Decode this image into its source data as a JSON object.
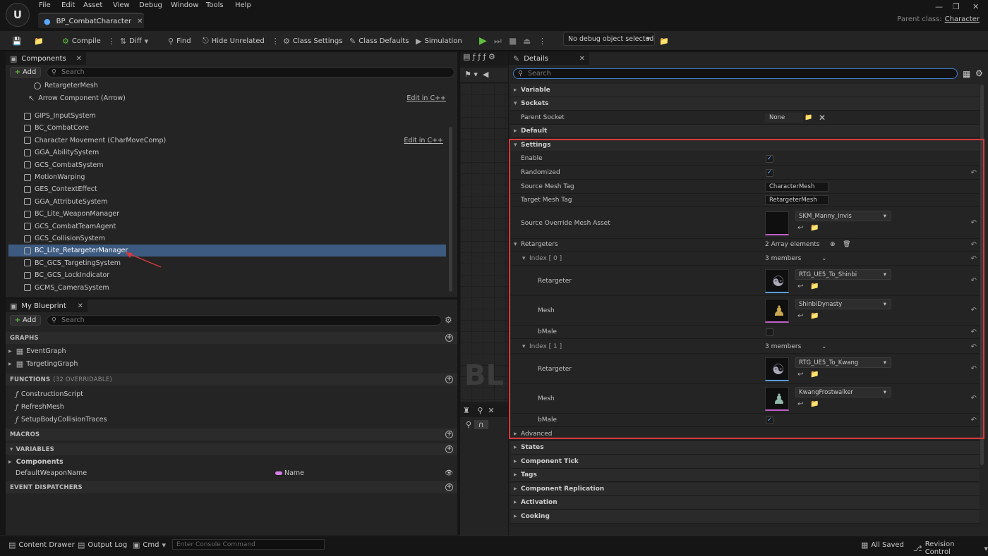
{
  "menu": [
    "File",
    "Edit",
    "Asset",
    "View",
    "Debug",
    "Window",
    "Tools",
    "Help"
  ],
  "tab": {
    "title": "BP_CombatCharacter"
  },
  "parent_class": {
    "label": "Parent class:",
    "value": "Character"
  },
  "toolbar": {
    "compile": "Compile",
    "diff": "Diff",
    "find": "Find",
    "hide_unrelated": "Hide Unrelated",
    "class_settings": "Class Settings",
    "class_defaults": "Class Defaults",
    "simulation": "Simulation",
    "debug_object": "No debug object selected"
  },
  "components": {
    "title": "Components",
    "add": "Add",
    "search_placeholder": "Search",
    "edit_cpp": "Edit in C++",
    "top_items": [
      "RetargeterMesh",
      "Arrow Component (Arrow)"
    ],
    "items": [
      "GIPS_InputSystem",
      "BC_CombatCore",
      "Character Movement (CharMoveComp)",
      "GGA_AbilitySystem",
      "GCS_CombatSystem",
      "MotionWarping",
      "GES_ContextEffect",
      "GGA_AttributeSystem",
      "BC_Lite_WeaponManager",
      "GCS_CombatTeamAgent",
      "GCS_CollisionSystem",
      "BC_Lite_RetargeterManager",
      "BC_GCS_TargetingSystem",
      "BC_GCS_LockIndicator",
      "GCMS_CameraSystem"
    ],
    "selected": "BC_Lite_RetargeterManager"
  },
  "my_blueprint": {
    "title": "My Blueprint",
    "add": "Add",
    "search_placeholder": "Search",
    "graphs_header": "GRAPHS",
    "graphs": [
      "EventGraph",
      "TargetingGraph"
    ],
    "functions_header": "FUNCTIONS",
    "functions_note": "(32 OVERRIDABLE)",
    "functions": [
      "ConstructionScript",
      "RefreshMesh",
      "SetupBodyCollisionTraces"
    ],
    "macros_header": "MACROS",
    "variables_header": "VARIABLES",
    "var_group": "Components",
    "var_name": "DefaultWeaponName",
    "var_type": "Name",
    "dispatchers_header": "EVENT DISPATCHERS"
  },
  "details": {
    "title": "Details",
    "search_placeholder": "Search",
    "cat_variable": "Variable",
    "cat_sockets": "Sockets",
    "parent_socket_label": "Parent Socket",
    "parent_socket_value": "None",
    "cat_default": "Default",
    "cat_settings": "Settings",
    "enable": "Enable",
    "randomized": "Randomized",
    "source_mesh_tag": "Source Mesh Tag",
    "source_mesh_tag_value": "CharacterMesh",
    "target_mesh_tag": "Target Mesh Tag",
    "target_mesh_tag_value": "RetargeterMesh",
    "source_override": "Source Override Mesh Asset",
    "source_override_value": "SKM_Manny_Invis",
    "retargeters": "Retargeters",
    "retargeters_value": "2 Array elements",
    "index0": "Index [ 0 ]",
    "index1": "Index [ 1 ]",
    "members": "3 members",
    "retargeter_label": "Retargeter",
    "mesh_label": "Mesh",
    "bmale_label": "bMale",
    "r0": "RTG_UE5_To_Shinbi",
    "m0": "ShinbiDynasty",
    "r1": "RTG_UE5_To_Kwang",
    "m1": "KwangFrostwalker",
    "cat_advanced": "Advanced",
    "cat_states": "States",
    "cat_component_tick": "Component Tick",
    "cat_tags": "Tags",
    "cat_replication": "Component Replication",
    "cat_activation": "Activation",
    "cat_cooking": "Cooking"
  },
  "graph_watermark": "BL",
  "statusbar": {
    "content_drawer": "Content Drawer",
    "output_log": "Output Log",
    "cmd": "Cmd",
    "console_placeholder": "Enter Console Command",
    "all_saved": "All Saved",
    "revision_control": "Revision Control"
  },
  "colors": {
    "selection": "#3d5a80",
    "highlight_box": "#d9393e",
    "accent_blue": "#5aa8ff",
    "play_green": "#5fbf3f"
  }
}
